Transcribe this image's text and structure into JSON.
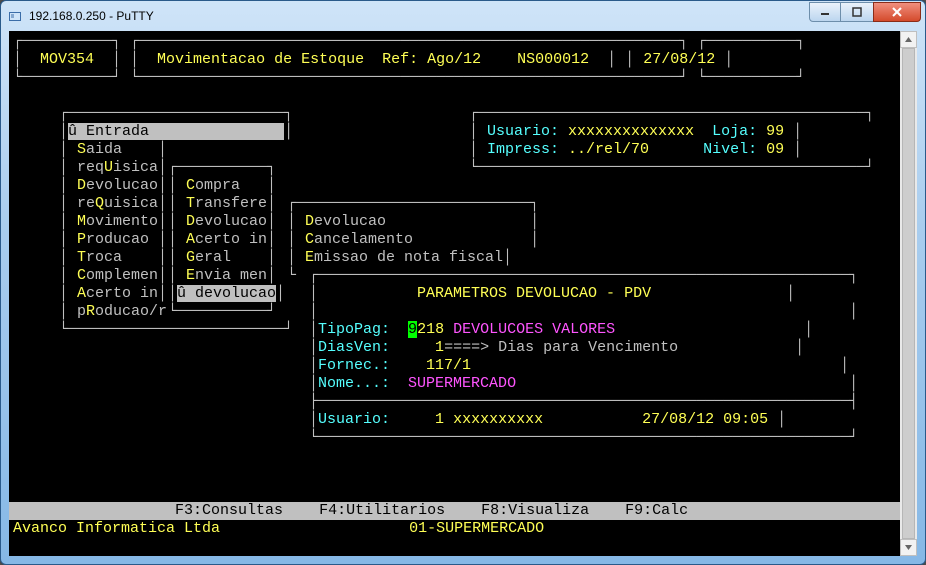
{
  "window": {
    "title": "192.168.0.250 - PuTTY"
  },
  "header": {
    "code": "MOV354",
    "title": "Movimentacao de Estoque",
    "ref": "Ref: Ago/12",
    "ns": "NS000012",
    "date": "27/08/12"
  },
  "info": {
    "usuario_label": "Usuario:",
    "usuario_value": "xxxxxxxxxxxxxx",
    "loja_label": "Loja:",
    "loja_value": "99",
    "impress_label": "Impress:",
    "impress_value": "../rel/70",
    "nivel_label": "Nivel:",
    "nivel_value": "09"
  },
  "menu1": {
    "selected": "û Entrada",
    "items": [
      "Saida",
      "reqUisica",
      "Devolucao",
      "reQuisica",
      "Movimento",
      "Producao",
      "Troca",
      "Complemen",
      "Acerto in",
      "pRoducao/req.cons/que"
    ]
  },
  "menu2": {
    "items": [
      "Compra",
      "Transfere",
      "Devolucao",
      "Acerto in",
      "Geral",
      "Envia men"
    ],
    "selected": "û devolucao"
  },
  "menu3": {
    "items": [
      "Devolucao",
      "Cancelamento",
      "Emissao de nota fiscal"
    ]
  },
  "panel": {
    "title": "PARAMETROS DEVOLUCAO - PDV",
    "tipopag_label": "TipoPag:",
    "tipopag_cursor": "9",
    "tipopag_rest": "218",
    "tipopag_desc": "DEVOLUCOES VALORES",
    "diasven_label": "DiasVen:",
    "diasven_value": "1",
    "diasven_desc": "====> Dias para Vencimento",
    "fornec_label": "Fornec.:",
    "fornec_value": "117/1",
    "nome_label": "Nome...:",
    "nome_value": "SUPERMERCADO",
    "usuario_label": "Usuario:",
    "usuario_value": "1",
    "usuario_name": "xxxxxxxxxx",
    "datetime": "27/08/12 09:05"
  },
  "footerbar": {
    "f3": "F3:Consultas",
    "f4": "F4:Utilitarios",
    "f8": "F8:Visualiza",
    "f9": "F9:Calc"
  },
  "statusbar": {
    "company": "Avanco Informatica Ltda",
    "store": "01-SUPERMERCADO"
  }
}
